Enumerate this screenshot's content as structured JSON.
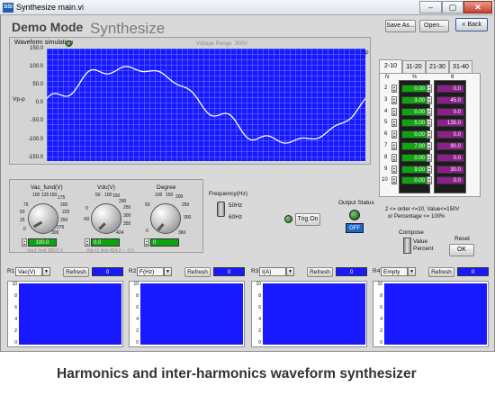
{
  "window": {
    "title": "Synthesize main.vi",
    "app_icon": "SSI",
    "controls": [
      "–",
      "▢",
      "✕"
    ]
  },
  "header": {
    "mode": "Demo Mode",
    "title": "Synthesize",
    "save_as": "Save As...",
    "open": "Open...",
    "back": "Back",
    "back_icon": "double-chevron-left"
  },
  "waveform": {
    "label": "Waveform simulation",
    "voltage_range_label": "Voltage Range",
    "voltage_range_value": "300V",
    "ovp_label": "OVP",
    "y_axis_label": "Vp-p",
    "y_ticks": [
      "150.0",
      "100.0",
      "50.0",
      "0.0",
      "-50.0",
      "-100.0",
      "-150.0"
    ],
    "ylim": [
      -150,
      150
    ],
    "plot_color": "#1919ff",
    "trace_color": "#ffffff"
  },
  "harmonics": {
    "tabs": [
      "2-10",
      "11-20",
      "21-30",
      "31-40"
    ],
    "active_tab": "2-10",
    "col_n": "N",
    "col_pct": "%",
    "col_theta": "θ",
    "rows": [
      {
        "n": "2",
        "pct": "0.00",
        "theta": "0.0"
      },
      {
        "n": "3",
        "pct": "3.00",
        "theta": "45.0"
      },
      {
        "n": "4",
        "pct": "0.00",
        "theta": "0.0"
      },
      {
        "n": "5",
        "pct": "5.00",
        "theta": "135.0"
      },
      {
        "n": "6",
        "pct": "0.00",
        "theta": "0.0"
      },
      {
        "n": "7",
        "pct": "7.00",
        "theta": "90.0"
      },
      {
        "n": "8",
        "pct": "0.00",
        "theta": "0.0"
      },
      {
        "n": "9",
        "pct": "9.00",
        "theta": "30.0"
      },
      {
        "n": "10",
        "pct": "0.00",
        "theta": "0.0"
      }
    ],
    "note_line1": "2 <= order <=10,  Value<=150V",
    "note_line2": "or Percentage <= 100%"
  },
  "compose": {
    "label": "Compose",
    "option_value": "Value",
    "option_percent": "Percent",
    "reset_label": "Reset",
    "ok_label": "OK"
  },
  "knobs": [
    {
      "label": "Vac_fund(V)",
      "value": "100.0",
      "sub": "Vac1 limit   300.0  V",
      "ticks": [
        "100",
        "125",
        "150",
        "175",
        "200",
        "225",
        "250",
        "275",
        "300",
        "75",
        "50",
        "25",
        "0"
      ]
    },
    {
      "label": "Vdc(V)",
      "value": "0.0",
      "sub": "Vdc+1 limit   424.3  ~  -3.0",
      "ticks": [
        "50",
        "100",
        "150",
        "200",
        "250",
        "300",
        "350",
        "424",
        "0",
        "-50"
      ]
    },
    {
      "label": "Degree",
      "value": "0",
      "sub": "",
      "ticks": [
        "100",
        "150",
        "200",
        "250",
        "300",
        "360",
        "50",
        "0"
      ]
    }
  ],
  "frequency": {
    "label": "Frequency(Hz)",
    "opt_50": "50Hz",
    "opt_60": "60Hz"
  },
  "trig_on": "Trig On",
  "output_status": {
    "label": "Output Status",
    "value": "OFF"
  },
  "readouts": [
    {
      "id": "R1",
      "select": "Vac(V)",
      "refresh": "Refresh",
      "value": "0"
    },
    {
      "id": "R2",
      "select": "F(Hz)",
      "refresh": "Refresh",
      "value": "0"
    },
    {
      "id": "R3",
      "select": "I(A)",
      "refresh": "Refresh",
      "value": "0"
    },
    {
      "id": "R4",
      "select": "Empty",
      "refresh": "Refresh",
      "value": "0"
    }
  ],
  "mini_ticks": [
    "10",
    "8",
    "6",
    "4",
    "2",
    "0"
  ],
  "caption": "Harmonics and inter-harmonics waveform synthesizer",
  "colors": {
    "accent_blue": "#1919ff",
    "value_green": "#0fa30f",
    "value_purple": "#8b1f8b"
  }
}
